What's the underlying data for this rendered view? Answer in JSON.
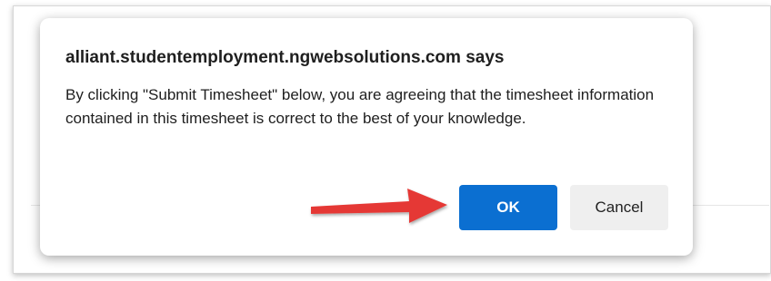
{
  "dialog": {
    "title": "alliant.studentemployment.ngwebsolutions.com says",
    "message": "By clicking \"Submit Timesheet\" below, you are agreeing that the timesheet information contained in this timesheet is correct to the best of your knowledge.",
    "ok_label": "OK",
    "cancel_label": "Cancel"
  },
  "annotation": {
    "icon": "red-arrow-icon",
    "color": "#e53935"
  },
  "colors": {
    "ok_button": "#0b6fd1",
    "cancel_button": "#efefef"
  }
}
